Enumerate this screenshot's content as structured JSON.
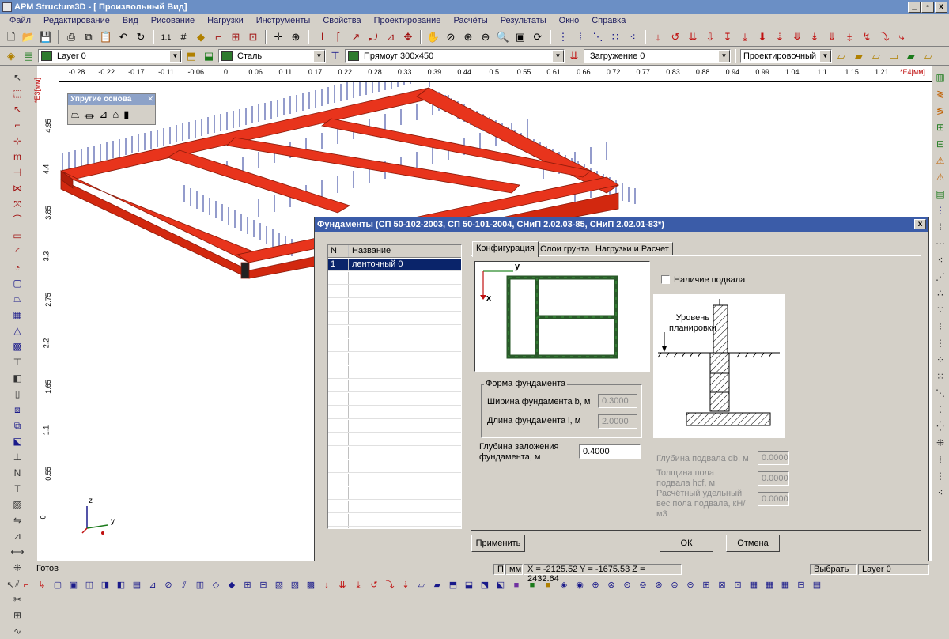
{
  "window": {
    "title": "APM Structure3D - [ Произвольный Вид]",
    "min": "_",
    "restore": "▫",
    "close": "x"
  },
  "menu": [
    "Файл",
    "Редактирование",
    "Вид",
    "Рисование",
    "Нагрузки",
    "Инструменты",
    "Свойства",
    "Проектирование",
    "Расчёты",
    "Результаты",
    "Окно",
    "Справка"
  ],
  "toolbar2": {
    "layer": "Layer 0",
    "material": "Сталь",
    "section": "Прямоуг 300x450",
    "loading": "Загружение 0",
    "mode": "Проектировочный",
    "layer_color": "#2d7a2d",
    "material_color": "#2d7a2d",
    "section_color": "#2d7a2d"
  },
  "ruler_top": {
    "unit": "*E4[мм]",
    "ticks": [
      "-0.28",
      "-0.22",
      "-0.17",
      "-0.11",
      "-0.06",
      "0",
      "0.06",
      "0.11",
      "0.17",
      "0.22",
      "0.28",
      "0.33",
      "0.39",
      "0.44",
      "0.5",
      "0.55",
      "0.61",
      "0.66",
      "0.72",
      "0.77",
      "0.83",
      "0.88",
      "0.94",
      "0.99",
      "1.04",
      "1.1",
      "1.15",
      "1.21"
    ]
  },
  "ruler_left": {
    "unit": "*E3[мм]",
    "ticks": [
      "4.95",
      "4.4",
      "3.85",
      "3.3",
      "2.75",
      "2.2",
      "1.65",
      "1.1",
      "0.55",
      "0"
    ]
  },
  "elastic_panel": {
    "title": "Упругие основа"
  },
  "axes": {
    "z": "z",
    "y": "y"
  },
  "dialog": {
    "title": "Фундаменты (СП 50-102-2003, СП 50-101-2004, СНиП 2.02.03-85, СНиП 2.02.01-83*)",
    "close": "x",
    "list": {
      "col_n": "N",
      "col_name": "Название",
      "rows": [
        {
          "n": "1",
          "name": "ленточный 0"
        }
      ]
    },
    "tabs": [
      "Конфигурация",
      "Слои грунта",
      "Нагрузки и Расчет"
    ],
    "plan": {
      "x": "x",
      "y": "y"
    },
    "basement_checkbox": "Наличие подвала",
    "section_label": "Уровень\nпланировки",
    "form_group": "Форма фундамента",
    "width_label": "Ширина фундамента b, м",
    "width_value": "0.3000",
    "length_label": "Длина фундамента l, м",
    "length_value": "2.0000",
    "depth_label": "Глубина заложения фундамента, м",
    "depth_value": "0.4000",
    "basement_depth_label": "Глубина подвала db, м",
    "basement_depth_value": "0.0000",
    "floor_thickness_label": "Толщина пола подвала hcf, м",
    "floor_thickness_value": "0.0000",
    "floor_weight_label": "Расчётный удельный вес пола подвала, кН/м3",
    "floor_weight_value": "0.0000",
    "apply": "Применить",
    "ok": "ОК",
    "cancel": "Отмена"
  },
  "status": {
    "ready": "Готов",
    "p": "П",
    "mm": "мм",
    "coords": "X = -2125.52 Y = -1675.53 Z = 2432.64",
    "select": "Выбрать",
    "layer": "Layer 0"
  }
}
